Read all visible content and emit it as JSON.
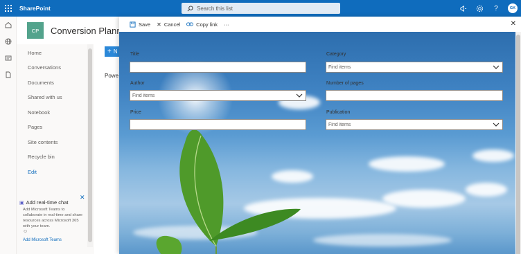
{
  "suite": {
    "brand": "SharePoint",
    "search_placeholder": "Search this list",
    "avatar_initials": "GK"
  },
  "site": {
    "logo_initials": "CP",
    "title": "Conversion Planne"
  },
  "leftnav": {
    "items": [
      "Home",
      "Conversations",
      "Documents",
      "Shared with us",
      "Notebook",
      "Pages",
      "Site contents",
      "Recycle bin"
    ],
    "edit_label": "Edit"
  },
  "chat_card": {
    "title": "Add real-time chat",
    "description": "Add Microsoft Teams to collaborate in real-time and share resources across Microsoft 365 with your team.",
    "smile": "☺",
    "link": "Add Microsoft Teams"
  },
  "behind": {
    "new_label": "N",
    "partial_text": "Powe"
  },
  "panel": {
    "commands": {
      "save": "Save",
      "cancel": "Cancel",
      "copy_link": "Copy link",
      "more": "···"
    },
    "fields": {
      "title_label": "Title",
      "title_value": "",
      "author_label": "Author",
      "author_placeholder": "Find items",
      "price_label": "Price",
      "price_value": "",
      "category_label": "Category",
      "category_placeholder": "Find items",
      "pages_label": "Number of pages",
      "pages_value": "",
      "publication_label": "Publication",
      "publication_placeholder": "Find items"
    }
  },
  "colors": {
    "suite_bar": "#0f6cbd",
    "site_logo": "#53a38c",
    "accent": "#0f6cbd"
  },
  "icons": [
    "app-launcher-icon",
    "search-icon",
    "megaphone-icon",
    "settings-icon",
    "help-icon",
    "home-icon",
    "globe-icon",
    "news-icon",
    "document-icon",
    "save-icon",
    "close-icon",
    "link-icon",
    "more-icon",
    "chevron-down-icon",
    "teams-icon"
  ]
}
